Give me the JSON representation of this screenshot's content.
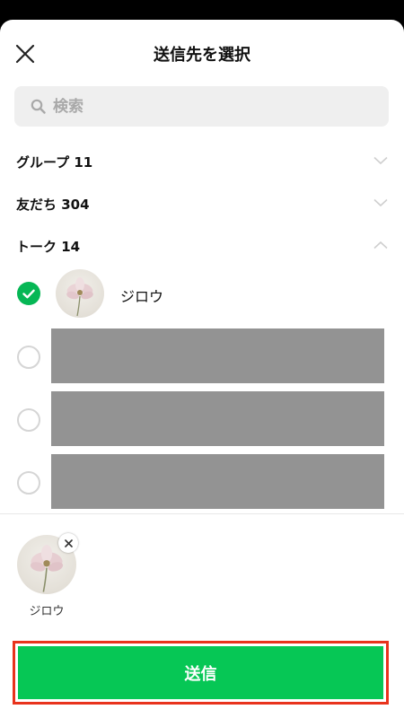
{
  "header": {
    "title": "送信先を選択",
    "close_icon": "close-icon"
  },
  "search": {
    "placeholder": "検索",
    "icon": "search-icon"
  },
  "sections": [
    {
      "label": "グループ 11",
      "expanded": false
    },
    {
      "label": "友だち 304",
      "expanded": false
    },
    {
      "label": "トーク 14",
      "expanded": true
    }
  ],
  "talk_items": [
    {
      "name": "ジロウ",
      "checked": true
    },
    {
      "name": "",
      "checked": false,
      "redacted": true
    },
    {
      "name": "",
      "checked": false,
      "redacted": true
    },
    {
      "name": "",
      "checked": false,
      "redacted": true
    }
  ],
  "selected": [
    {
      "name": "ジロウ"
    }
  ],
  "send_button": {
    "label": "送信"
  },
  "colors": {
    "brand_green": "#06c755",
    "check_green": "#06b755",
    "highlight_red": "#e8331c",
    "search_bg": "#efefef",
    "redacted_gray": "#939393"
  }
}
